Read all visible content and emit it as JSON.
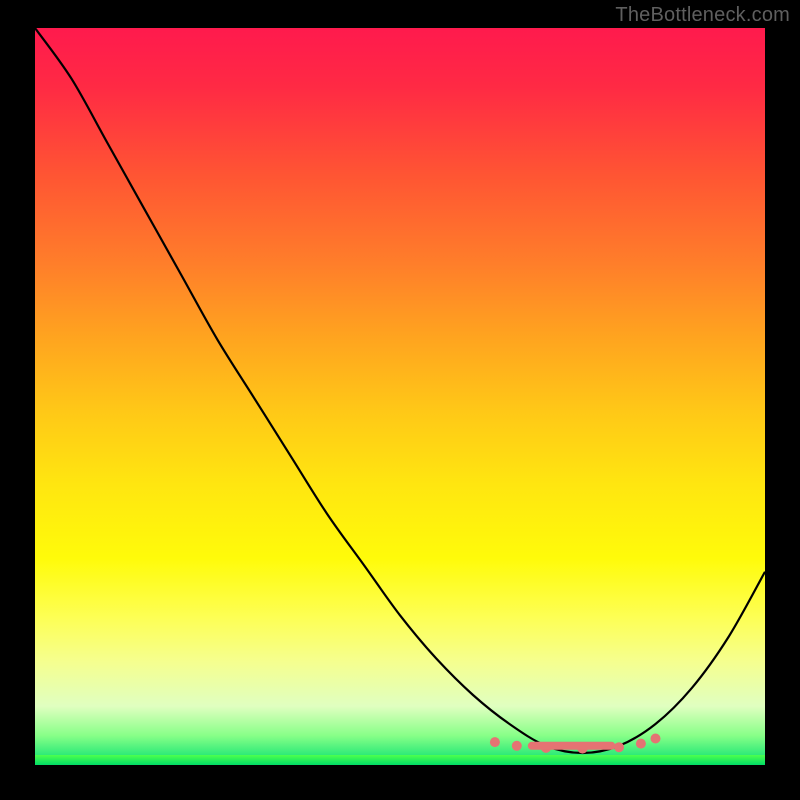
{
  "watermark": "TheBottleneck.com",
  "chart_data": {
    "type": "line",
    "title": "",
    "xlabel": "",
    "ylabel": "",
    "x": [
      0.0,
      0.05,
      0.1,
      0.15,
      0.2,
      0.25,
      0.3,
      0.35,
      0.4,
      0.45,
      0.5,
      0.55,
      0.6,
      0.65,
      0.7,
      0.75,
      0.8,
      0.85,
      0.9,
      0.95,
      1.0
    ],
    "values": [
      1.0,
      0.93,
      0.84,
      0.75,
      0.66,
      0.57,
      0.49,
      0.41,
      0.33,
      0.26,
      0.19,
      0.13,
      0.08,
      0.04,
      0.01,
      0.0,
      0.01,
      0.04,
      0.09,
      0.16,
      0.25
    ],
    "xlim": [
      0,
      1
    ],
    "ylim": [
      0,
      1
    ],
    "valley_x": 0.75,
    "valley_markers": [
      {
        "x": 0.63,
        "y": 0.985
      },
      {
        "x": 0.66,
        "y": 0.99
      },
      {
        "x": 0.7,
        "y": 0.993
      },
      {
        "x": 0.75,
        "y": 0.994
      },
      {
        "x": 0.8,
        "y": 0.992
      },
      {
        "x": 0.83,
        "y": 0.987
      },
      {
        "x": 0.85,
        "y": 0.98
      }
    ],
    "gradient": "red-to-green-vertical",
    "annotations": []
  }
}
